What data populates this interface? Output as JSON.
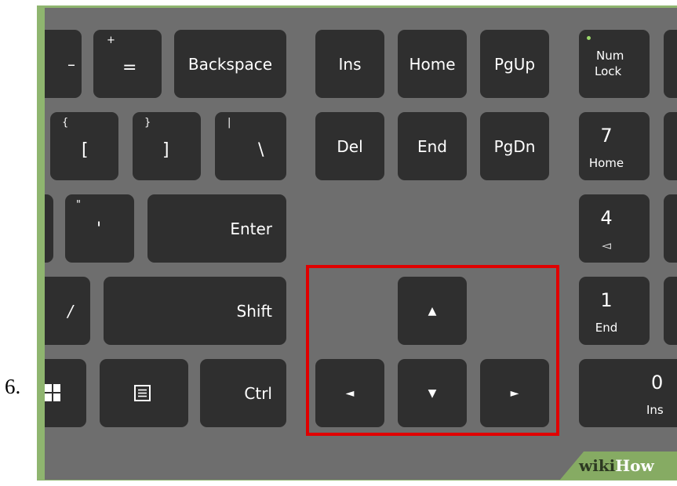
{
  "step_number": "6.",
  "keys": {
    "minus": "–",
    "equals_top": "+",
    "equals_main": "=",
    "backspace": "Backspace",
    "ins": "Ins",
    "home": "Home",
    "pgup": "PgUp",
    "numlock_line1": "Num",
    "numlock_line2": "Lock",
    "bracket_open_top": "{",
    "bracket_open_main": "[",
    "bracket_close_top": "}",
    "bracket_close_main": "]",
    "pipe_top": "|",
    "backslash_main": "\\",
    "del": "Del",
    "end": "End",
    "pgdn": "PgDn",
    "num7": "7",
    "num7_sub": "Home",
    "quote_top": "\"",
    "quote_main": "'",
    "enter": "Enter",
    "num4": "4",
    "num4_sub": "◅",
    "slash": "/",
    "shift": "Shift",
    "arrow_up": "▲",
    "num1": "1",
    "num1_sub": "End",
    "ctrl": "Ctrl",
    "arrow_left": "◄",
    "arrow_down": "▼",
    "arrow_right": "►",
    "num0": "0",
    "num0_sub": "Ins"
  },
  "watermark": {
    "part1": "wiki",
    "part2": "How"
  },
  "colors": {
    "frame": "#8fb56f",
    "board": "#6e6e6e",
    "key": "#2f2f2f",
    "highlight": "#e00000"
  }
}
